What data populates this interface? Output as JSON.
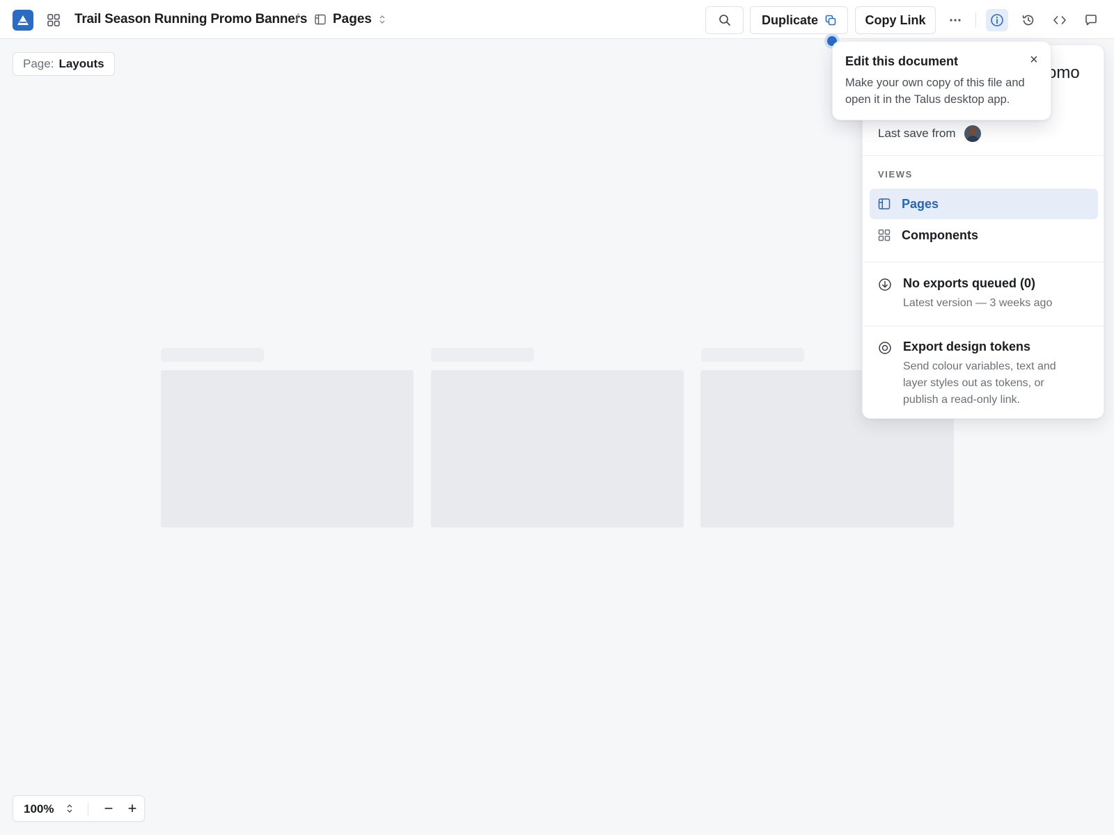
{
  "header": {
    "doc_title": "Trail Season Running Promo Banners",
    "breadcrumb_separator": "/",
    "view_label": "Pages",
    "buttons": {
      "duplicate": "Duplicate",
      "copy_link": "Copy Link",
      "more": "···"
    },
    "icons": [
      "app-logo",
      "apps-grid-icon",
      "pages-icon",
      "updown-chevron-icon",
      "search-icon",
      "duplicate-copy-icon",
      "more-icon",
      "info-icon",
      "history-icon",
      "code-icon",
      "comment-icon"
    ],
    "accent_color": "#2a6cc8"
  },
  "canvas": {
    "page_label": "Page:",
    "page_name": "Layouts",
    "placeholder_cards": 3
  },
  "info_panel": {
    "title_fragment": "omo",
    "last_save_label": "Last save from",
    "views_heading": "VIEWS",
    "views": [
      {
        "label": "Pages",
        "icon": "pages-icon",
        "selected": true
      },
      {
        "label": "Components",
        "icon": "components-grid-icon",
        "selected": false
      }
    ],
    "exports": {
      "title": "No exports queued (0)",
      "subtitle": "Latest version — 3 weeks ago"
    },
    "tokens": {
      "title": "Export design tokens",
      "subtitle": "Send colour variables, text and layer styles out as tokens, or publish a read-only link."
    }
  },
  "tooltip": {
    "title": "Edit this document",
    "body": "Make your own copy of this file and open it in the Talus desktop app.",
    "close": "×"
  },
  "zoom": {
    "value": "100%",
    "decrease": "−",
    "increase": "+"
  }
}
